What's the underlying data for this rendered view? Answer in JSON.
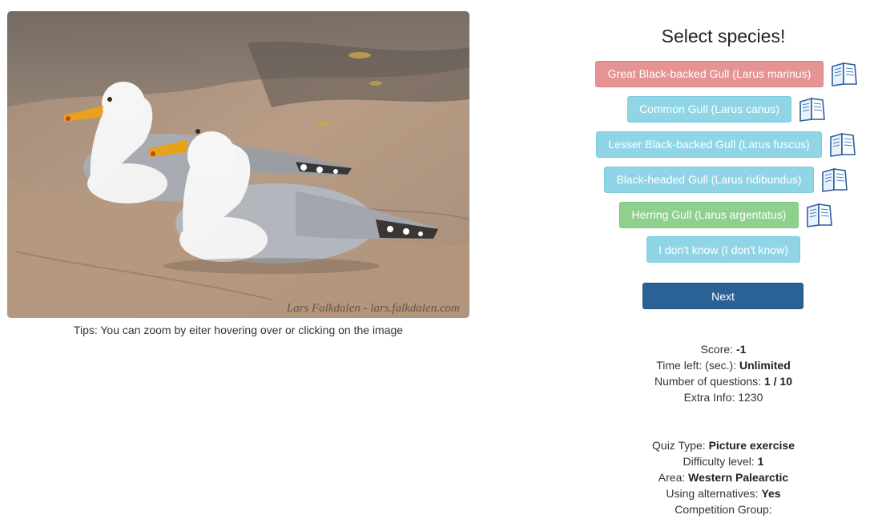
{
  "photo": {
    "credit": "Lars Falkdalen - lars.falkdalen.com"
  },
  "tips": "Tips: You can zoom by eiter hovering over or clicking on the image",
  "quiz": {
    "title": "Select species!",
    "options": [
      {
        "label": "Great Black-backed Gull (Larus marinus)",
        "state": "danger",
        "color": "#e59393"
      },
      {
        "label": "Common Gull (Larus canus)",
        "state": "info",
        "color": "#90d5e6"
      },
      {
        "label": "Lesser Black-backed Gull (Larus fuscus)",
        "state": "info",
        "color": "#90d5e6"
      },
      {
        "label": "Black-headed Gull (Larus ridibundus)",
        "state": "info",
        "color": "#90d5e6"
      },
      {
        "label": "Herring Gull (Larus argentatus)",
        "state": "success",
        "color": "#8fd08f"
      },
      {
        "label": "I don't know (I don't know)",
        "state": "info",
        "color": "#90d5e6"
      }
    ],
    "book_icon": "book-icon",
    "next_label": "Next"
  },
  "stats": {
    "score_label": "Score: ",
    "score_value": "-1",
    "time_label": "Time left: (sec.): ",
    "time_value": "Unlimited",
    "questions_label": "Number of questions: ",
    "questions_value": "1 / 10",
    "extra_label": "Extra Info: ",
    "extra_value": "1230"
  },
  "settings": {
    "quiz_type_label": "Quiz Type: ",
    "quiz_type_value": "Picture exercise",
    "difficulty_label": "Difficulty level: ",
    "difficulty_value": "1",
    "area_label": "Area: ",
    "area_value": "Western Palearctic",
    "alternatives_label": "Using alternatives: ",
    "alternatives_value": "Yes",
    "competition_label": "Competition Group: ",
    "competition_value": ""
  },
  "colors": {
    "next_button": "#2a6296",
    "info": "#90d5e6",
    "danger": "#e59393",
    "success": "#8fd08f"
  }
}
